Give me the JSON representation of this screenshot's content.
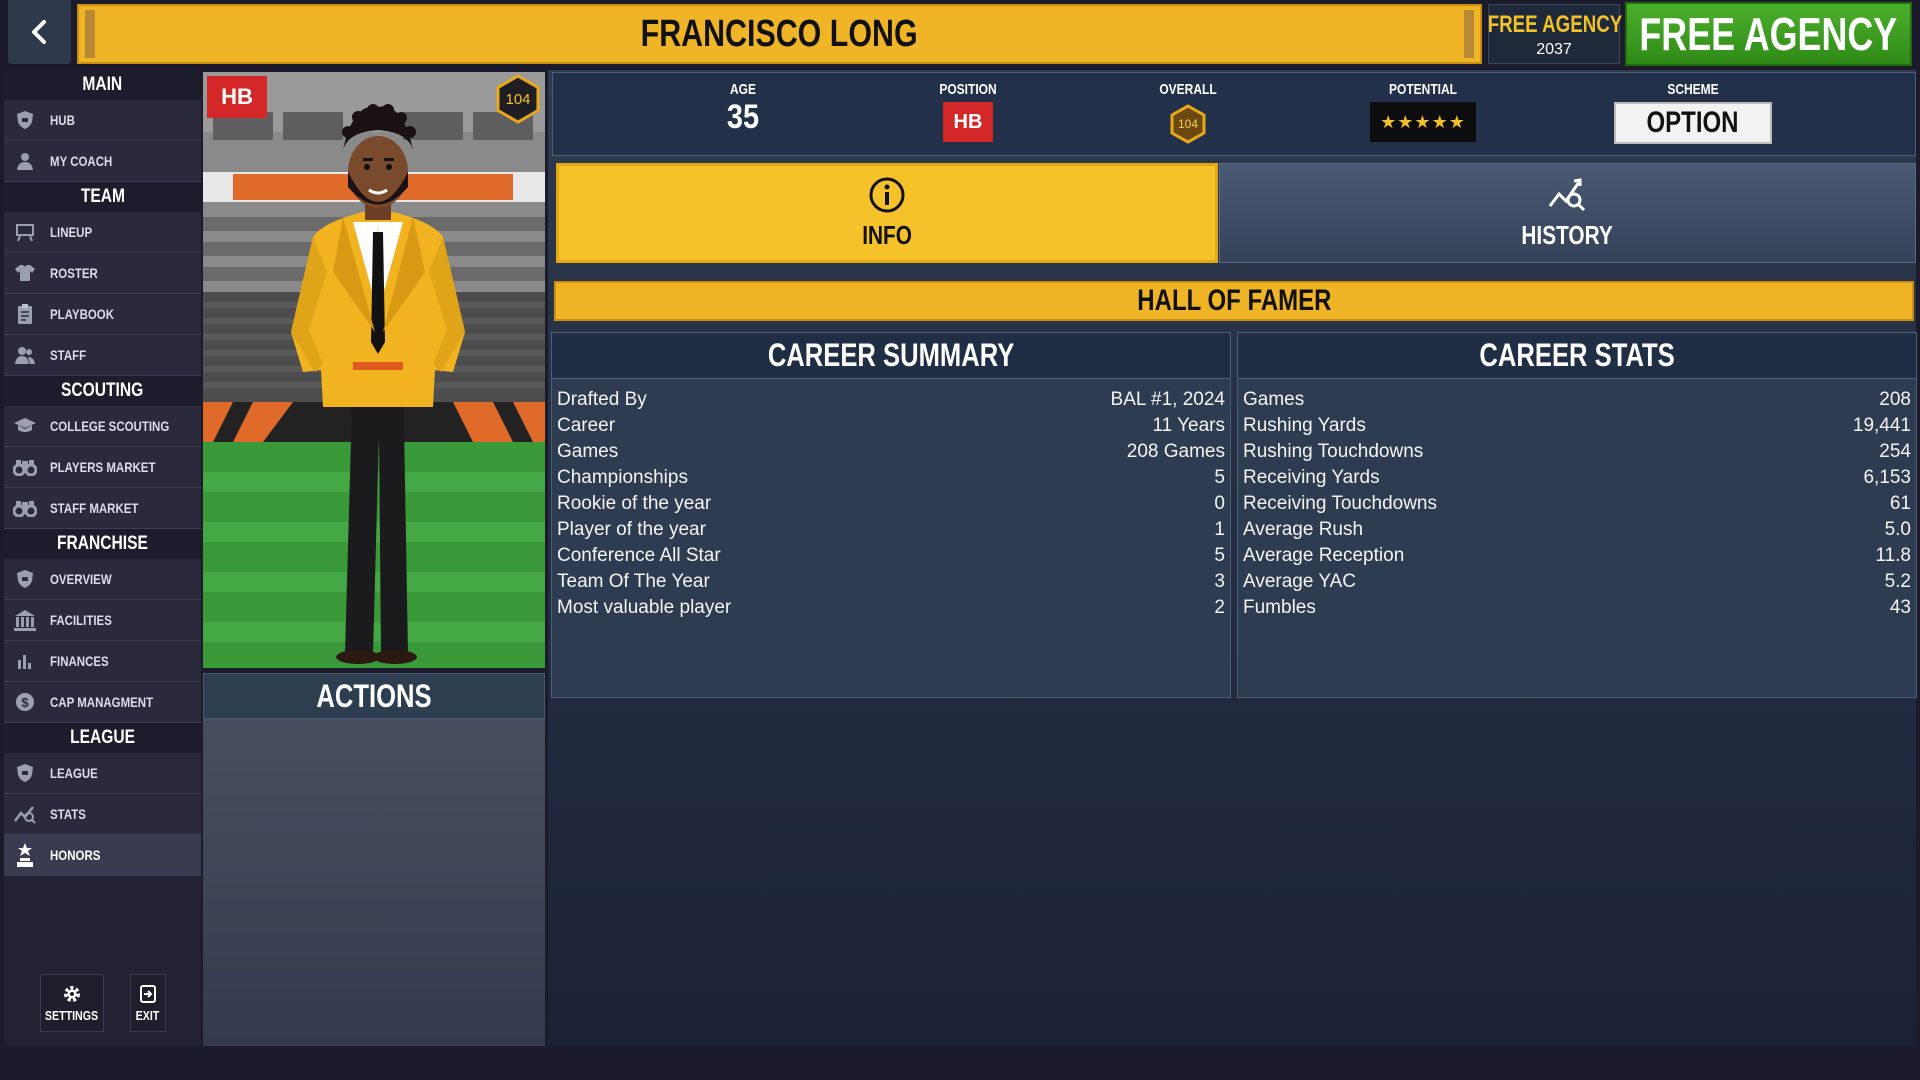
{
  "header": {
    "player_name": "FRANCISCO LONG",
    "mode_label": "FREE AGENCY",
    "year": "2037",
    "phase_button": "FREE AGENCY"
  },
  "sidebar": {
    "sections": [
      {
        "title": "MAIN",
        "items": [
          {
            "label": "HUB",
            "icon": "shield-icon"
          },
          {
            "label": "MY COACH",
            "icon": "person-icon"
          }
        ]
      },
      {
        "title": "TEAM",
        "items": [
          {
            "label": "LINEUP",
            "icon": "lineup-board-icon"
          },
          {
            "label": "ROSTER",
            "icon": "jersey-icon"
          },
          {
            "label": "PLAYBOOK",
            "icon": "clipboard-icon"
          },
          {
            "label": "STAFF",
            "icon": "staff-people-icon"
          }
        ]
      },
      {
        "title": "SCOUTING",
        "items": [
          {
            "label": "COLLEGE SCOUTING",
            "icon": "graduation-cap-icon"
          },
          {
            "label": "PLAYERS MARKET",
            "icon": "binoculars-icon"
          },
          {
            "label": "STAFF MARKET",
            "icon": "binoculars-icon"
          }
        ]
      },
      {
        "title": "FRANCHISE",
        "items": [
          {
            "label": "OVERVIEW",
            "icon": "shield-icon"
          },
          {
            "label": "FACILITIES",
            "icon": "building-icon"
          },
          {
            "label": "FINANCES",
            "icon": "bar-chart-icon"
          },
          {
            "label": "CAP MANAGMENT",
            "icon": "dollar-coin-icon"
          }
        ]
      },
      {
        "title": "LEAGUE",
        "items": [
          {
            "label": "LEAGUE",
            "icon": "shield-icon"
          },
          {
            "label": "STATS",
            "icon": "stats-chart-icon"
          },
          {
            "label": "HONORS",
            "icon": "trophy-icon",
            "active": true
          }
        ]
      }
    ],
    "settings_label": "SETTINGS",
    "exit_label": "EXIT"
  },
  "portrait": {
    "position_badge": "HB",
    "overall_badge": "104"
  },
  "actions": {
    "title": "ACTIONS"
  },
  "attributes": {
    "age_label": "AGE",
    "age_value": "35",
    "position_label": "POSITION",
    "position_value": "HB",
    "overall_label": "OVERALL",
    "overall_value": "104",
    "potential_label": "POTENTIAL",
    "potential_stars": 5,
    "potential_value": "★★★★★",
    "scheme_label": "SCHEME",
    "scheme_value": "OPTION"
  },
  "tabs": {
    "info": "INFO",
    "history": "HISTORY"
  },
  "hall_of_famer": "HALL OF FAMER",
  "career_summary": {
    "title": "CAREER SUMMARY",
    "rows": [
      {
        "label": "Drafted By",
        "value": "BAL #1, 2024"
      },
      {
        "label": "Career",
        "value": "11 Years"
      },
      {
        "label": "Games",
        "value": "208 Games"
      },
      {
        "label": "Championships",
        "value": "5"
      },
      {
        "label": "Rookie of the year",
        "value": "0"
      },
      {
        "label": "Player of the year",
        "value": "1"
      },
      {
        "label": "Conference All Star",
        "value": "5"
      },
      {
        "label": "Team Of The Year",
        "value": "3"
      },
      {
        "label": "Most valuable player",
        "value": "2"
      }
    ]
  },
  "career_stats": {
    "title": "CAREER STATS",
    "rows": [
      {
        "label": "Games",
        "value": "208"
      },
      {
        "label": "Rushing Yards",
        "value": "19,441"
      },
      {
        "label": "Rushing Touchdowns",
        "value": "254"
      },
      {
        "label": "Receiving Yards",
        "value": "6,153"
      },
      {
        "label": "Receiving Touchdowns",
        "value": "61"
      },
      {
        "label": "Average Rush",
        "value": "5.0"
      },
      {
        "label": "Average Reception",
        "value": "11.8"
      },
      {
        "label": "Average YAC",
        "value": "5.2"
      },
      {
        "label": "Fumbles",
        "value": "43"
      }
    ]
  },
  "colors": {
    "accent_yellow": "#f0b526",
    "free_agency_green": "#3c9e22",
    "position_red": "#d42828",
    "panel_navy": "#2e3c52"
  }
}
